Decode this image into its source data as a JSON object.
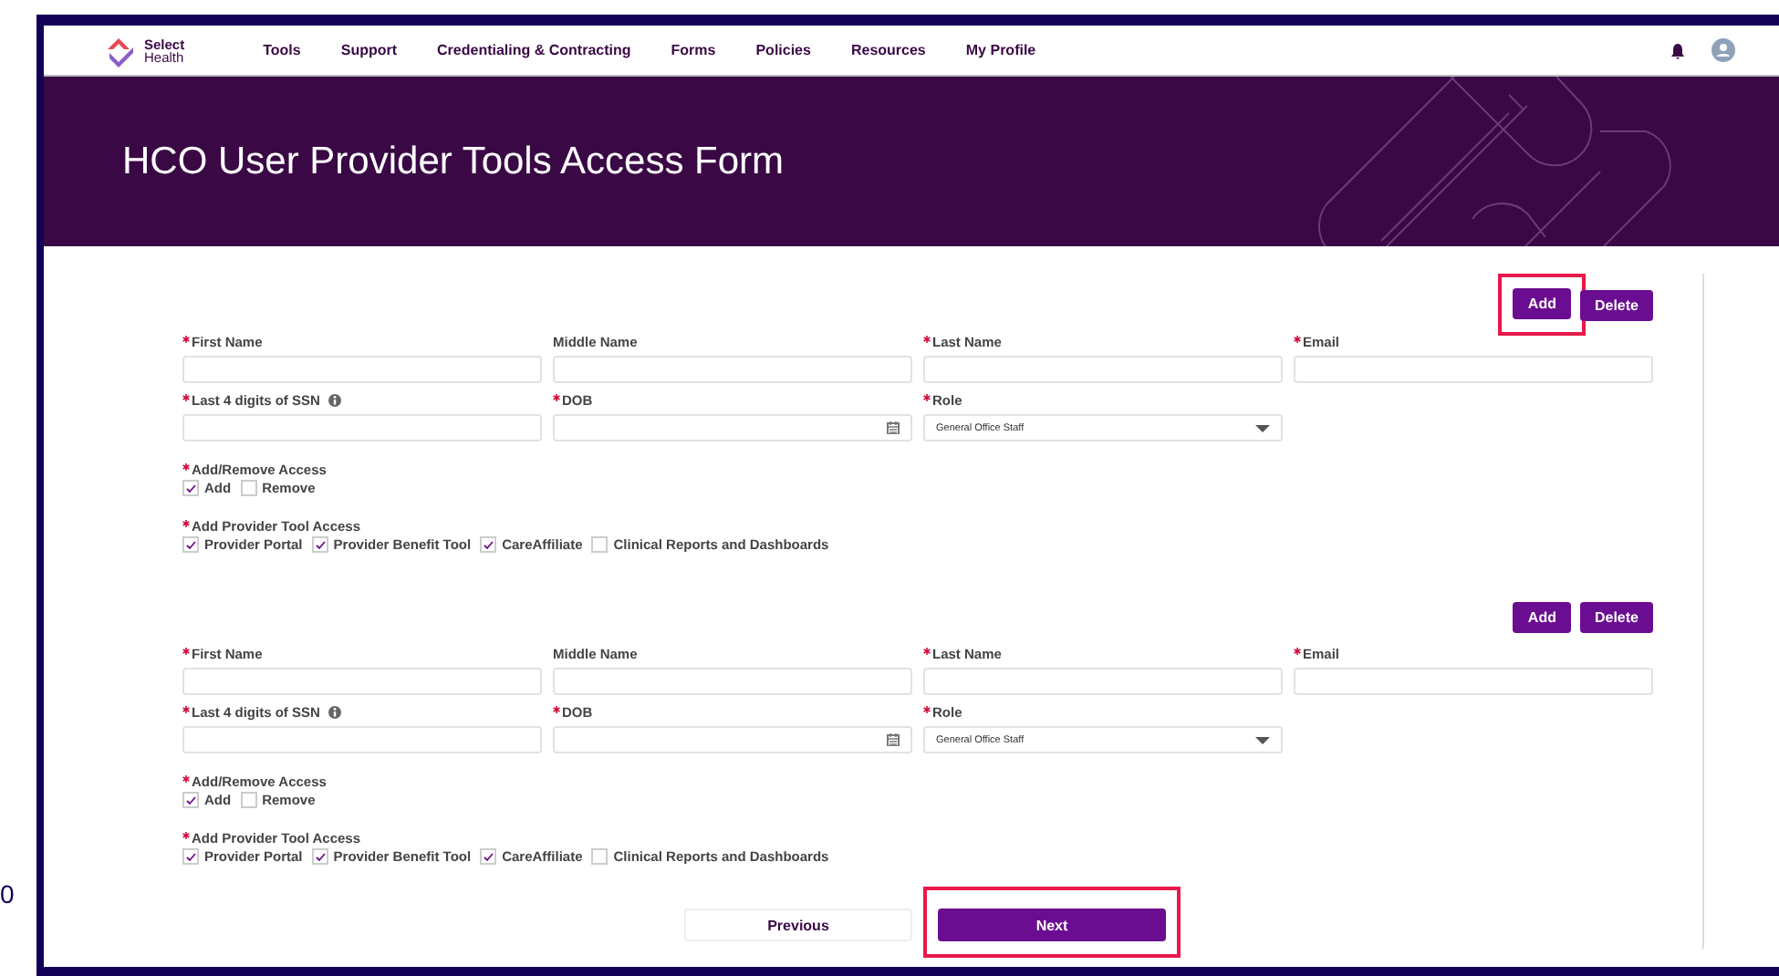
{
  "stray_text": "0",
  "header": {
    "logo": {
      "line1": "Select",
      "line2": "Health"
    },
    "nav": [
      {
        "label": "Tools"
      },
      {
        "label": "Support"
      },
      {
        "label": "Credentialing & Contracting"
      },
      {
        "label": "Forms"
      },
      {
        "label": "Policies"
      },
      {
        "label": "Resources"
      },
      {
        "label": "My Profile"
      }
    ]
  },
  "banner": {
    "title": "HCO User Provider Tools Access Form"
  },
  "entries": [
    {
      "actions": [
        {
          "label": "Add",
          "highlighted": true
        },
        {
          "label": "Delete",
          "highlighted": false
        }
      ],
      "fields": [
        {
          "kind": "text",
          "label": "First Name",
          "required": true
        },
        {
          "kind": "text",
          "label": "Middle Name",
          "required": false
        },
        {
          "kind": "text",
          "label": "Last Name",
          "required": true
        },
        {
          "kind": "text",
          "label": "Email",
          "required": true
        },
        {
          "kind": "text",
          "label": "Last 4 digits of SSN",
          "required": true,
          "info": true
        },
        {
          "kind": "date",
          "label": "DOB",
          "required": true
        },
        {
          "kind": "select",
          "label": "Role",
          "required": true,
          "value": "General Office Staff"
        }
      ],
      "groups": [
        {
          "label": "Add/Remove Access",
          "required": true,
          "options": [
            {
              "label": "Add",
              "checked": true
            },
            {
              "label": "Remove",
              "checked": false
            }
          ]
        },
        {
          "label": "Add Provider Tool Access",
          "required": true,
          "options": [
            {
              "label": "Provider Portal",
              "checked": true
            },
            {
              "label": "Provider Benefit Tool",
              "checked": true
            },
            {
              "label": "CareAffiliate",
              "checked": true
            },
            {
              "label": "Clinical Reports and Dashboards",
              "checked": false
            }
          ]
        }
      ]
    },
    {
      "actions": [
        {
          "label": "Add",
          "highlighted": false
        },
        {
          "label": "Delete",
          "highlighted": false
        }
      ],
      "fields": [
        {
          "kind": "text",
          "label": "First Name",
          "required": true
        },
        {
          "kind": "text",
          "label": "Middle Name",
          "required": false
        },
        {
          "kind": "text",
          "label": "Last Name",
          "required": true
        },
        {
          "kind": "text",
          "label": "Email",
          "required": true
        },
        {
          "kind": "text",
          "label": "Last 4 digits of SSN",
          "required": true,
          "info": true
        },
        {
          "kind": "date",
          "label": "DOB",
          "required": true
        },
        {
          "kind": "select",
          "label": "Role",
          "required": true,
          "value": "General Office Staff"
        }
      ],
      "groups": [
        {
          "label": "Add/Remove Access",
          "required": true,
          "options": [
            {
              "label": "Add",
              "checked": true
            },
            {
              "label": "Remove",
              "checked": false
            }
          ]
        },
        {
          "label": "Add Provider Tool Access",
          "required": true,
          "options": [
            {
              "label": "Provider Portal",
              "checked": true
            },
            {
              "label": "Provider Benefit Tool",
              "checked": true
            },
            {
              "label": "CareAffiliate",
              "checked": true
            },
            {
              "label": "Clinical Reports and Dashboards",
              "checked": false
            }
          ]
        }
      ]
    }
  ],
  "footer_buttons": [
    {
      "label": "Previous",
      "kind": "secondary",
      "highlighted": false
    },
    {
      "label": "Next",
      "kind": "primary",
      "highlighted": true
    }
  ]
}
